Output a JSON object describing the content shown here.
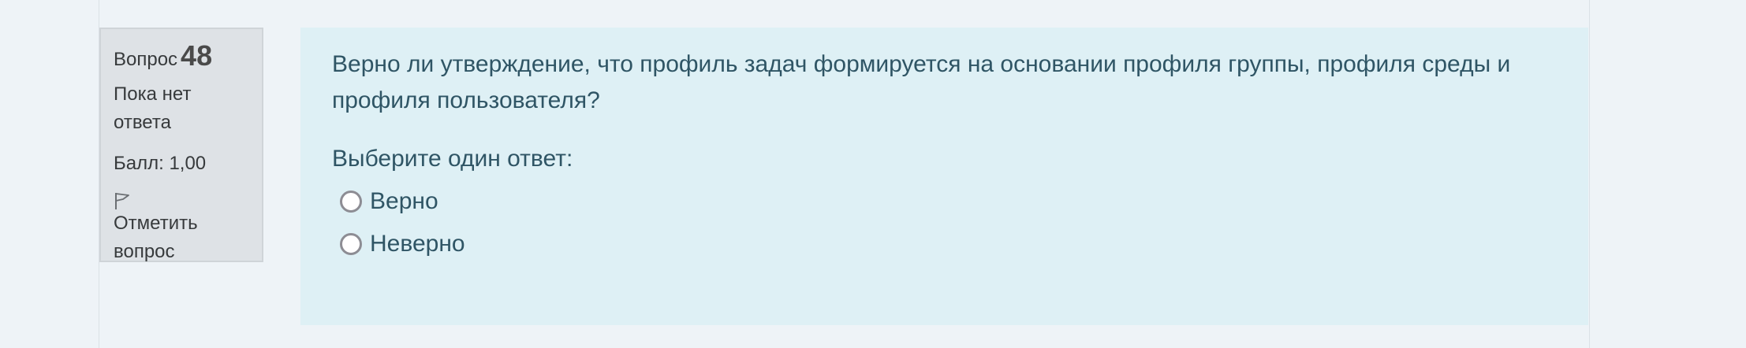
{
  "question": {
    "label": "Вопрос",
    "number": "48",
    "status": "Пока нет ответа",
    "score": "Балл: 1,00",
    "flag_label": "Отметить вопрос",
    "text": "Верно ли утверждение, что профиль задач формируется на основании профиля группы, профиля среды и профиля пользователя?",
    "prompt": "Выберите один ответ:",
    "options": [
      {
        "label": "Верно",
        "selected": false
      },
      {
        "label": "Неверно",
        "selected": false
      }
    ]
  },
  "icons": {
    "flag": "flag-icon",
    "radio": "radio-unselected-icon"
  },
  "colors": {
    "question_text": "#2f5565",
    "info_bg": "#dee2e6",
    "content_bg": "#def0f5",
    "page_bg": "#eef3f7"
  }
}
